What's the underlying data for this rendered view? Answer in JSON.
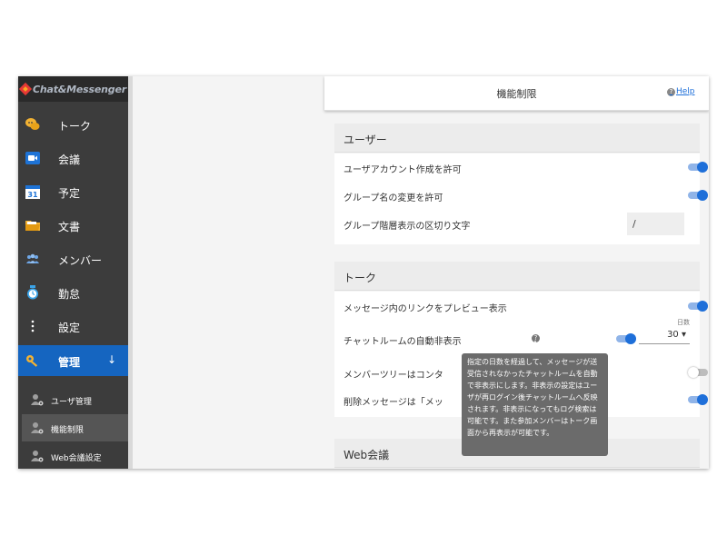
{
  "logo": {
    "text": "Chat&Messenger"
  },
  "sidebar": {
    "items": [
      {
        "label": "トーク",
        "icon": "chat-bubbles-icon"
      },
      {
        "label": "会議",
        "icon": "video-camera-icon"
      },
      {
        "label": "予定",
        "icon": "calendar-icon",
        "icon_text": "31"
      },
      {
        "label": "文書",
        "icon": "folder-icon"
      },
      {
        "label": "メンバー",
        "icon": "people-icon"
      },
      {
        "label": "勤怠",
        "icon": "clock-icon"
      },
      {
        "label": "設定",
        "icon": "more-vertical-icon"
      },
      {
        "label": "管理",
        "icon": "key-icon",
        "active": true,
        "expand_glyph": "↓"
      }
    ],
    "sub_items": [
      {
        "label": "ユーザ管理",
        "icon": "user-gear-icon"
      },
      {
        "label": "機能制限",
        "icon": "user-gear-icon",
        "active": true
      },
      {
        "label": "Web会議設定",
        "icon": "user-gear-icon"
      }
    ]
  },
  "panel": {
    "title": "機能制限",
    "help_label": "Help",
    "help_icon_glyph": "?"
  },
  "sections": {
    "user": {
      "title": "ユーザー",
      "rows": {
        "create_account": {
          "label": "ユーザアカウント作成を許可",
          "enabled": true
        },
        "change_group_name": {
          "label": "グループ名の変更を許可",
          "enabled": true
        },
        "group_separator": {
          "label": "グループ階層表示の区切り文字",
          "value": "/"
        }
      }
    },
    "talk": {
      "title": "トーク",
      "rows": {
        "link_preview": {
          "label": "メッセージ内のリンクをプレビュー表示",
          "enabled": true
        },
        "auto_hide": {
          "label": "チャットルームの自動非表示",
          "enabled": true,
          "days_label": "日数",
          "days_value": "30 ▾",
          "info_glyph": "?"
        },
        "member_tree": {
          "label": "メンバーツリーはコンタ",
          "enabled": false
        },
        "deleted_message": {
          "label": "削除メッセージは「メッ",
          "enabled": true
        }
      }
    },
    "web_meeting": {
      "title": "Web会議"
    }
  },
  "tooltip": {
    "text": "指定の日数を経過して、メッセージが送受信されなかったチャットルームを自動で非表示にします。非表示の設定はユーザが再ログイン後チャットルームへ反映されます。非表示になってもログ検索は可能です。また参加メンバーはトーク画面から再表示が可能です。"
  },
  "colors": {
    "sidebar_bg": "#3c3c3c",
    "accent": "#1565c0",
    "toggle_on": "#1e6fd9",
    "tooltip_bg": "#6b6b6b"
  }
}
